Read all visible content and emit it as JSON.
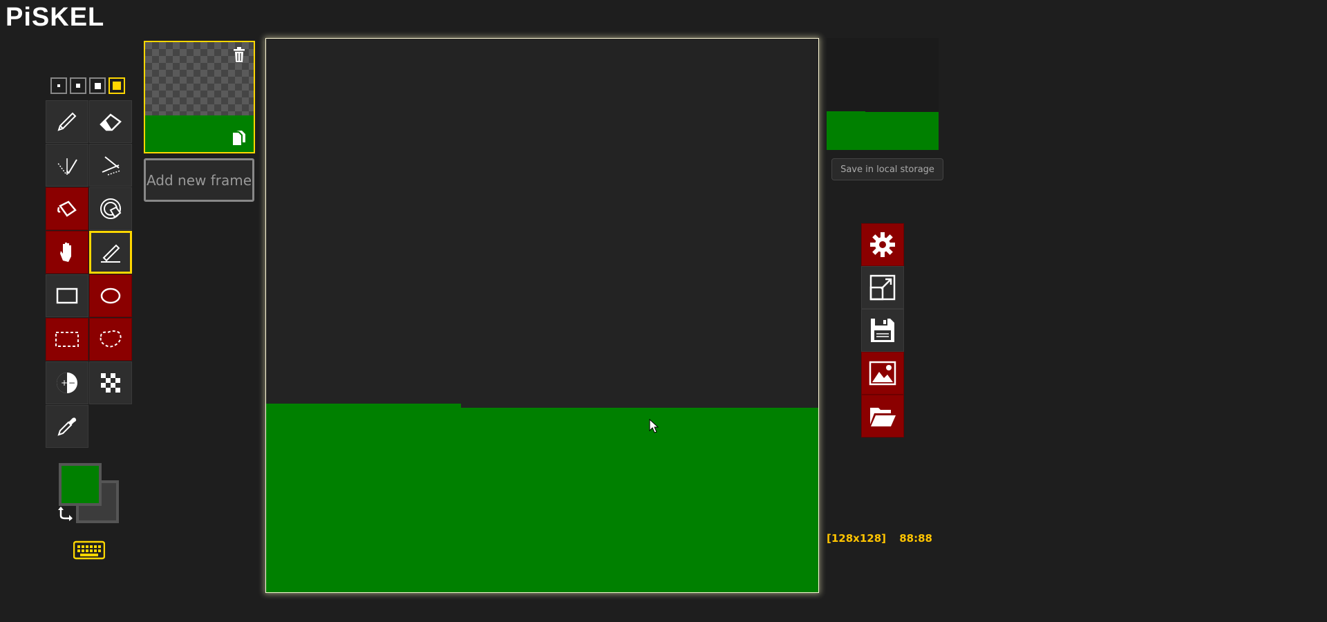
{
  "app": {
    "logo": "PiSKEL"
  },
  "pen_sizes": [
    {
      "name": "pen-size-1",
      "selected": false
    },
    {
      "name": "pen-size-2",
      "selected": false
    },
    {
      "name": "pen-size-3",
      "selected": false
    },
    {
      "name": "pen-size-4",
      "selected": true
    }
  ],
  "tools": [
    {
      "icon": "pencil-icon",
      "active": false
    },
    {
      "icon": "eraser-icon",
      "active": false
    },
    {
      "icon": "vertical-mirror-pen-icon",
      "active": false
    },
    {
      "icon": "stroke-line-icon",
      "active": false
    },
    {
      "icon": "paint-bucket-icon",
      "active": true
    },
    {
      "icon": "paint-all-same-color-icon",
      "active": false
    },
    {
      "icon": "move-hand-icon",
      "active": true
    },
    {
      "icon": "pen-selected-icon",
      "active": false,
      "selected": true
    },
    {
      "icon": "rectangle-icon",
      "active": false
    },
    {
      "icon": "ellipse-icon",
      "active": true
    },
    {
      "icon": "rectangle-select-icon",
      "active": true
    },
    {
      "icon": "lasso-select-icon",
      "active": true
    },
    {
      "icon": "lighten-darken-icon",
      "active": false
    },
    {
      "icon": "dithering-icon",
      "active": false
    },
    {
      "icon": "color-picker-icon",
      "active": false
    }
  ],
  "colors": {
    "primary": "#008000",
    "secondary": "#3c3c3c",
    "accent": "#ffd700",
    "active_tool": "#8b0000"
  },
  "frames": {
    "add_label": "Add new frame"
  },
  "preview": {
    "save_label": "Save in local storage"
  },
  "settings": [
    {
      "icon": "gear-icon",
      "active": true
    },
    {
      "icon": "resize-icon",
      "active": false
    },
    {
      "icon": "floppy-save-icon",
      "active": false
    },
    {
      "icon": "image-export-icon",
      "active": true
    },
    {
      "icon": "folder-open-icon",
      "active": true
    }
  ],
  "status": {
    "size": "[128x128]",
    "coords": "88:88"
  }
}
